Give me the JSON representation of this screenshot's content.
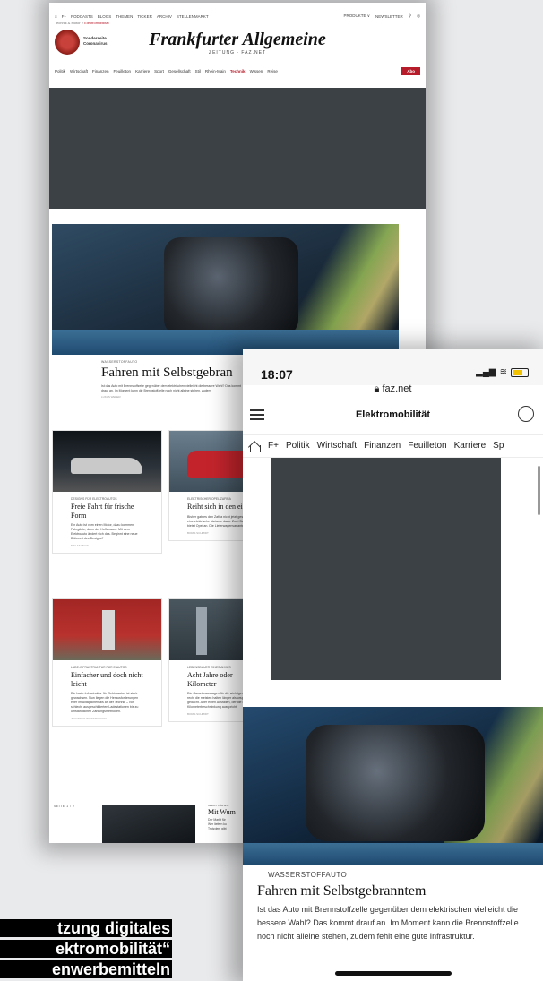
{
  "desktop": {
    "topnav": [
      "≡",
      "F+",
      "PODCASTS",
      "BLOGS",
      "THEMEN",
      "TICKER",
      "ARCHIV",
      "STELLENMARKT"
    ],
    "topnav_right": [
      "PRODUKTE ∨",
      "NEWSLETTER"
    ],
    "breadcrumb": {
      "parent": "Technik & Motor",
      "sep": ">",
      "current": "Elektromobilität"
    },
    "corona_label": "Sonderseite Coronavirus",
    "logo": "Frankfurter Allgemeine",
    "logo_sub": "ZEITUNG · FAZ.NET",
    "catnav": [
      "Politik",
      "Wirtschaft",
      "Finanzen",
      "Feuilleton",
      "Karriere",
      "Sport",
      "Gesellschaft",
      "Stil",
      "Rhein-Main",
      "Technik",
      "Wissen",
      "Reise"
    ],
    "catnav_active": "Technik",
    "abo_label": "Abo",
    "hero_article": {
      "kicker": "WASSERSTOFFAUTO",
      "title": "Fahren mit Selbstgebran",
      "text": "Ist das Auto mit Brennstoffzelle gegenüber dem elektrischen vielleicht die bessere Wahl? Das kommt drauf an. Im Moment kann die Brennstoffzelle noch nicht alleine stehen, zudem",
      "meta": "LUKAS WEBER"
    },
    "cards": [
      {
        "kicker": "DESIGNS FÜR ELEKTROAUTOS",
        "title": "Freie Fahrt für frische Form",
        "text": "Ein Auto ist vom einen Motor, dazu kommen Fahrgäste, dann der Kofferraum. Mit dem Elektroauto ändert sich das. Beginnt eine neue Blütezeit des Designs?",
        "meta": "NIKLAS MAAK"
      },
      {
        "kicker": "ELEKTRISCHER OPEL ZAFIRA",
        "title": "Reiht sich in den ein",
        "text": "Bisher gab es den Zafira nicht jetzt gesellt sich eine elektrische Variante dazu. Zwei Batterien bietet Opel an. Die Lieferwagenvariante heißt",
        "meta": "BORIS SCHMIDT"
      },
      {
        "kicker": "LADE-INFRASTRUKTUR FÜR E-AUTOS",
        "title": "Einfacher und doch nicht leicht",
        "text": "Die Lade-Infrastruktur für Elektroautos ist stark gewachsen. Nun liegen die Herausforderungen eher im Alltäglichen als an der Technik – von schlecht ausgeschilderten Ladestationen bis zu umständlichen Zahlungsmethoden.",
        "meta": "JOHANNES WINTERHAGEN"
      },
      {
        "kicker": "LEBENSDAUER EINES AKKUS",
        "title": "Acht Jahre oder Kilometer",
        "text": "Die Garantieaussagen für die wichtigen Akkus sind recht die meisten halten länger als ursprünglich gedacht. Aber einen Ausfallen, der die ohne Kilometerbeschränkung ausspricht.",
        "meta": "BORIS SCHMIDT"
      }
    ],
    "pager": "SEITE 1 / 2",
    "last_article": {
      "kicker": "MARKT FÜR E-A",
      "title": "Mit Wum",
      "text": "Der Markt für\nWer liefern ku\nTrotzdem gibt"
    }
  },
  "phone": {
    "time": "18:07",
    "url": "faz.net",
    "title": "Elektromobilität",
    "nav": [
      "F+",
      "Politik",
      "Wirtschaft",
      "Finanzen",
      "Feuilleton",
      "Karriere",
      "Sp"
    ],
    "article": {
      "kicker": "WASSERSTOFFAUTO",
      "title": "Fahren mit Selbstgebranntem",
      "text": "Ist das Auto mit Brennstoffzelle gegenüber dem elektrischen vielleicht die bessere Wahl? Das kommt drauf an. Im Moment kann die Brennstoffzelle noch nicht alleine stehen, zudem fehlt eine gute Infrastruktur."
    }
  },
  "caption": [
    "tzung digitales",
    "ektromobilität“",
    "enwerbemitteln"
  ],
  "colors": {
    "accent": "#b71c2b",
    "ad_placeholder": "#3b4145"
  },
  "icons": [
    "menu-icon",
    "search-icon",
    "user-icon",
    "home-icon",
    "lock-icon",
    "signal-icon",
    "wifi-icon",
    "battery-icon",
    "coronavirus-icon"
  ]
}
